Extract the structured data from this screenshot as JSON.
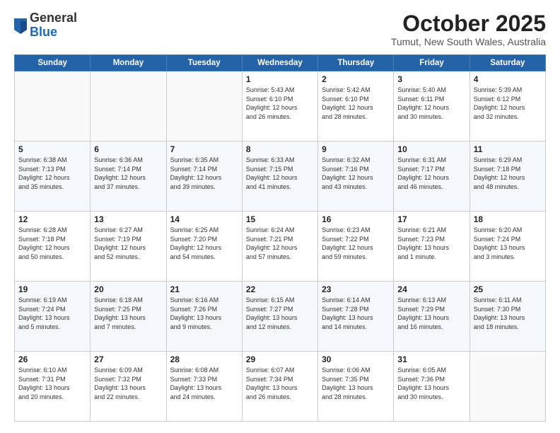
{
  "header": {
    "logo_general": "General",
    "logo_blue": "Blue",
    "month_title": "October 2025",
    "location": "Tumut, New South Wales, Australia"
  },
  "weekdays": [
    "Sunday",
    "Monday",
    "Tuesday",
    "Wednesday",
    "Thursday",
    "Friday",
    "Saturday"
  ],
  "weeks": [
    [
      {
        "day": "",
        "content": ""
      },
      {
        "day": "",
        "content": ""
      },
      {
        "day": "",
        "content": ""
      },
      {
        "day": "1",
        "content": "Sunrise: 5:43 AM\nSunset: 6:10 PM\nDaylight: 12 hours\nand 26 minutes."
      },
      {
        "day": "2",
        "content": "Sunrise: 5:42 AM\nSunset: 6:10 PM\nDaylight: 12 hours\nand 28 minutes."
      },
      {
        "day": "3",
        "content": "Sunrise: 5:40 AM\nSunset: 6:11 PM\nDaylight: 12 hours\nand 30 minutes."
      },
      {
        "day": "4",
        "content": "Sunrise: 5:39 AM\nSunset: 6:12 PM\nDaylight: 12 hours\nand 32 minutes."
      }
    ],
    [
      {
        "day": "5",
        "content": "Sunrise: 6:38 AM\nSunset: 7:13 PM\nDaylight: 12 hours\nand 35 minutes."
      },
      {
        "day": "6",
        "content": "Sunrise: 6:36 AM\nSunset: 7:14 PM\nDaylight: 12 hours\nand 37 minutes."
      },
      {
        "day": "7",
        "content": "Sunrise: 6:35 AM\nSunset: 7:14 PM\nDaylight: 12 hours\nand 39 minutes."
      },
      {
        "day": "8",
        "content": "Sunrise: 6:33 AM\nSunset: 7:15 PM\nDaylight: 12 hours\nand 41 minutes."
      },
      {
        "day": "9",
        "content": "Sunrise: 6:32 AM\nSunset: 7:16 PM\nDaylight: 12 hours\nand 43 minutes."
      },
      {
        "day": "10",
        "content": "Sunrise: 6:31 AM\nSunset: 7:17 PM\nDaylight: 12 hours\nand 46 minutes."
      },
      {
        "day": "11",
        "content": "Sunrise: 6:29 AM\nSunset: 7:18 PM\nDaylight: 12 hours\nand 48 minutes."
      }
    ],
    [
      {
        "day": "12",
        "content": "Sunrise: 6:28 AM\nSunset: 7:18 PM\nDaylight: 12 hours\nand 50 minutes."
      },
      {
        "day": "13",
        "content": "Sunrise: 6:27 AM\nSunset: 7:19 PM\nDaylight: 12 hours\nand 52 minutes."
      },
      {
        "day": "14",
        "content": "Sunrise: 6:25 AM\nSunset: 7:20 PM\nDaylight: 12 hours\nand 54 minutes."
      },
      {
        "day": "15",
        "content": "Sunrise: 6:24 AM\nSunset: 7:21 PM\nDaylight: 12 hours\nand 57 minutes."
      },
      {
        "day": "16",
        "content": "Sunrise: 6:23 AM\nSunset: 7:22 PM\nDaylight: 12 hours\nand 59 minutes."
      },
      {
        "day": "17",
        "content": "Sunrise: 6:21 AM\nSunset: 7:23 PM\nDaylight: 13 hours\nand 1 minute."
      },
      {
        "day": "18",
        "content": "Sunrise: 6:20 AM\nSunset: 7:24 PM\nDaylight: 13 hours\nand 3 minutes."
      }
    ],
    [
      {
        "day": "19",
        "content": "Sunrise: 6:19 AM\nSunset: 7:24 PM\nDaylight: 13 hours\nand 5 minutes."
      },
      {
        "day": "20",
        "content": "Sunrise: 6:18 AM\nSunset: 7:25 PM\nDaylight: 13 hours\nand 7 minutes."
      },
      {
        "day": "21",
        "content": "Sunrise: 6:16 AM\nSunset: 7:26 PM\nDaylight: 13 hours\nand 9 minutes."
      },
      {
        "day": "22",
        "content": "Sunrise: 6:15 AM\nSunset: 7:27 PM\nDaylight: 13 hours\nand 12 minutes."
      },
      {
        "day": "23",
        "content": "Sunrise: 6:14 AM\nSunset: 7:28 PM\nDaylight: 13 hours\nand 14 minutes."
      },
      {
        "day": "24",
        "content": "Sunrise: 6:13 AM\nSunset: 7:29 PM\nDaylight: 13 hours\nand 16 minutes."
      },
      {
        "day": "25",
        "content": "Sunrise: 6:11 AM\nSunset: 7:30 PM\nDaylight: 13 hours\nand 18 minutes."
      }
    ],
    [
      {
        "day": "26",
        "content": "Sunrise: 6:10 AM\nSunset: 7:31 PM\nDaylight: 13 hours\nand 20 minutes."
      },
      {
        "day": "27",
        "content": "Sunrise: 6:09 AM\nSunset: 7:32 PM\nDaylight: 13 hours\nand 22 minutes."
      },
      {
        "day": "28",
        "content": "Sunrise: 6:08 AM\nSunset: 7:33 PM\nDaylight: 13 hours\nand 24 minutes."
      },
      {
        "day": "29",
        "content": "Sunrise: 6:07 AM\nSunset: 7:34 PM\nDaylight: 13 hours\nand 26 minutes."
      },
      {
        "day": "30",
        "content": "Sunrise: 6:06 AM\nSunset: 7:35 PM\nDaylight: 13 hours\nand 28 minutes."
      },
      {
        "day": "31",
        "content": "Sunrise: 6:05 AM\nSunset: 7:36 PM\nDaylight: 13 hours\nand 30 minutes."
      },
      {
        "day": "",
        "content": ""
      }
    ]
  ]
}
